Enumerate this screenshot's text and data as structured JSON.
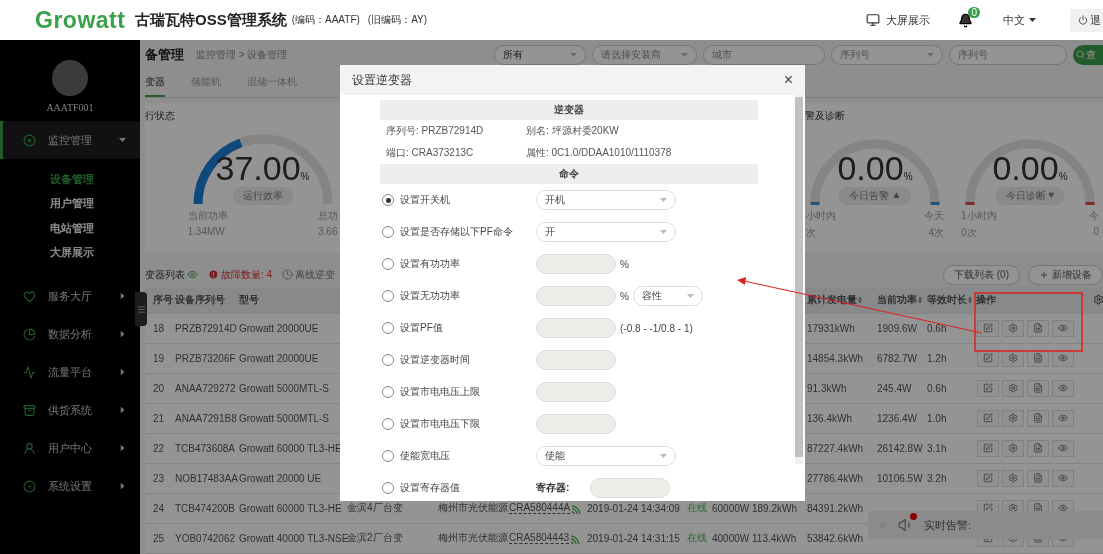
{
  "header": {
    "logo": "Growatt",
    "title": "古瑞瓦特OSS管理系统",
    "code": "(编码：AAATF)",
    "old_code": "(旧编码：AY)",
    "screen_link": "大屏展示",
    "notifications": "0",
    "language": "中文",
    "logout": "退"
  },
  "sidebar": {
    "user": "AAATF001",
    "items": [
      {
        "label": "监控管理",
        "expanded": true,
        "children": [
          {
            "label": "设备管理",
            "selected": true
          },
          {
            "label": "用户管理",
            "selected": false
          },
          {
            "label": "电站管理",
            "selected": false
          },
          {
            "label": "大屏展示",
            "selected": false
          }
        ]
      },
      {
        "label": "服务大厅",
        "expanded": false
      },
      {
        "label": "数据分析",
        "expanded": false
      },
      {
        "label": "流量平台",
        "expanded": false
      },
      {
        "label": "供货系统",
        "expanded": false
      },
      {
        "label": "用户中心",
        "expanded": false
      },
      {
        "label": "系统设置",
        "expanded": false
      }
    ]
  },
  "page": {
    "title": "备管理",
    "breadcrumb": "监控管理 > 设备管理",
    "filters": [
      {
        "kind": "select",
        "value": "所有"
      },
      {
        "kind": "select",
        "placeholder": "请选择安装商"
      },
      {
        "kind": "input",
        "placeholder": "城市"
      },
      {
        "kind": "select",
        "placeholder": "序列号"
      },
      {
        "kind": "input",
        "placeholder": "序列号"
      }
    ],
    "search_button": "查"
  },
  "tabs": [
    {
      "label": "变器",
      "selected": true
    },
    {
      "label": "储能机",
      "selected": false
    },
    {
      "label": "混储一体机",
      "selected": false
    }
  ],
  "status_card": {
    "title": "行状态",
    "value": "37.00",
    "unit": "%",
    "label": "运行效率",
    "level": 0.37,
    "stats": [
      {
        "label": "当前功率",
        "value": "1.34MW"
      },
      {
        "label": "总功",
        "value": "3.66"
      }
    ]
  },
  "alarm_card": {
    "title": "警及诊断",
    "gauges": [
      {
        "kind": "alarm",
        "value": "0.00",
        "unit": "%",
        "label": "今日告警",
        "mark": "▲",
        "stats": [
          {
            "label": "小时内",
            "value": "次"
          },
          {
            "label": "今天",
            "value": "4次"
          }
        ]
      },
      {
        "kind": "diagnosis",
        "value": "0.00",
        "unit": "%",
        "label": "今日诊断",
        "mark": "♥",
        "stats": [
          {
            "label": "1小时内",
            "value": "0次"
          },
          {
            "label": "今",
            "value": "0"
          }
        ]
      }
    ]
  },
  "list_toolbar": {
    "title": "变器列表",
    "fault": "故障数量: 4",
    "offline": "离线逆变",
    "download": "下载列表 (0)",
    "add": "新增设备"
  },
  "table": {
    "columns": [
      {
        "label": "序号",
        "sortable": false
      },
      {
        "label": "设备序列号",
        "sortable": false
      },
      {
        "label": "型号",
        "sortable": false
      },
      {
        "label": "累计发电量",
        "sortable": true
      },
      {
        "label": "当前功率",
        "sortable": true
      },
      {
        "label": "等效时长",
        "sortable": true
      },
      {
        "label": "操作",
        "sortable": false
      }
    ],
    "rows": [
      {
        "index": "18",
        "serial": "PRZB72914D",
        "model": "Growatt 20000UE",
        "total_energy": "17931kWh",
        "power": "1909.6W",
        "hours": "0.6h"
      },
      {
        "index": "19",
        "serial": "PRZB73206F",
        "model": "Growatt 20000UE",
        "total_energy": "14854.3kWh",
        "power": "6782.7W",
        "hours": "1.2h"
      },
      {
        "index": "20",
        "serial": "ANAA729272",
        "model": "Growatt 5000MTL-S",
        "total_energy": "91.3kWh",
        "power": "245.4W",
        "hours": "0.6h"
      },
      {
        "index": "21",
        "serial": "ANAA7291B8",
        "model": "Growatt 5000MTL-S",
        "total_energy": "136.4kWh",
        "power": "1236.4W",
        "hours": "1.0h"
      },
      {
        "index": "22",
        "serial": "TCB473608A",
        "model": "Growatt 60000 TL3-HE",
        "total_energy": "87227.4kWh",
        "power": "26142.8W",
        "hours": "3.1h"
      },
      {
        "index": "23",
        "serial": "NOB17483AA",
        "model": "Growatt 20000 UE",
        "total_energy": "27786.4kWh",
        "power": "10106.5W",
        "hours": "3.2h"
      },
      {
        "index": "24",
        "serial": "TCB474200B",
        "model": "Growatt 60000 TL3-HE",
        "plant": "金滨4厂台变",
        "owner": "梅州市光伏能源",
        "datalogger": "CRA580444A",
        "time": "2019-01-24 14:34:09",
        "status": "在线",
        "rated_power": "60000W",
        "today_energy": "189.2kWh",
        "total_energy": "84391.2kWh"
      },
      {
        "index": "25",
        "serial": "YOB0742062",
        "model": "Growatt 40000 TL3-NSE",
        "plant": "金滨2厂台变",
        "owner": "梅州市光伏能源",
        "datalogger": "CRA5804443",
        "time": "2019-01-24 14:31:15",
        "status": "在线",
        "rated_power": "40000W",
        "today_energy": "113.4kWh",
        "total_energy": "53842.6kWh"
      }
    ]
  },
  "alert_popup": {
    "label": "实时告警:"
  },
  "modal": {
    "title": "设置逆变器",
    "close": "×",
    "info_header": "逆变器",
    "info": [
      "序列号: PRZB72914D",
      "别名: 坪源村委20KW",
      "端口: CRA373213C",
      "属性: 0C1.0/DDAA1010/1110378"
    ],
    "commands_header": "命令",
    "commands": [
      {
        "label": "设置开关机",
        "selected": true,
        "kind": "select",
        "value": "开机"
      },
      {
        "label": "设置是否存储以下PF命令",
        "selected": false,
        "kind": "select",
        "value": "开"
      },
      {
        "label": "设置有功功率",
        "selected": false,
        "kind": "input",
        "unit": "%"
      },
      {
        "label": "设置无功功率",
        "selected": false,
        "kind": "input_select",
        "unit": "%",
        "value": "容性"
      },
      {
        "label": "设置PF值",
        "selected": false,
        "kind": "input",
        "unit": "(-0.8 - -1/0.8 - 1)"
      },
      {
        "label": "设置逆变器时间",
        "selected": false,
        "kind": "input"
      },
      {
        "label": "设置市电电压上限",
        "selected": false,
        "kind": "input"
      },
      {
        "label": "设置市电电压下限",
        "selected": false,
        "kind": "input"
      },
      {
        "label": "使能宽电压",
        "selected": false,
        "kind": "select",
        "value": "使能"
      },
      {
        "label": "设置寄存器值",
        "selected": false,
        "kind": "register",
        "field_label": "寄存器:"
      }
    ]
  }
}
